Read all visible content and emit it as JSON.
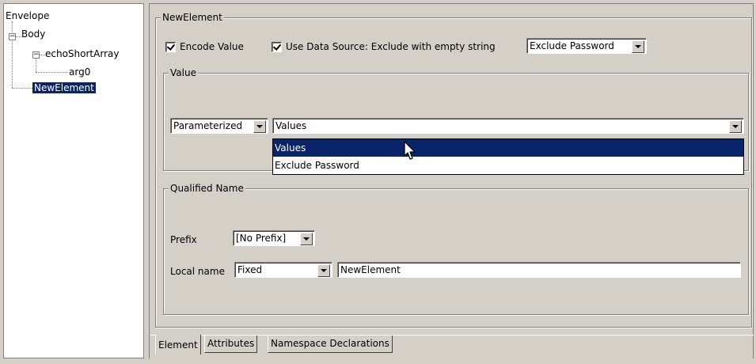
{
  "tree": {
    "nodes": [
      {
        "label": "Envelope"
      },
      {
        "label": "Body"
      },
      {
        "label": "echoShortArray"
      },
      {
        "label": "arg0"
      },
      {
        "label": "NewElement"
      }
    ]
  },
  "element_group": {
    "title": "NewElement",
    "encode_value_label": "Encode Value",
    "use_data_source_label": "Use Data Source: Exclude with empty string",
    "exclude_combo_value": "Exclude Password"
  },
  "value_group": {
    "title": "Value",
    "mode_combo_value": "Parameterized",
    "values_combo_value": "Values",
    "dropdown_options": [
      "Values",
      "Exclude Password"
    ]
  },
  "qualified_name_group": {
    "title": "Qualified Name",
    "prefix_label": "Prefix",
    "prefix_combo_value": "[No Prefix]",
    "local_name_label": "Local name",
    "local_name_mode_value": "Fixed",
    "local_name_value": "NewElement"
  },
  "tabs": [
    "Element",
    "Attributes",
    "Namespace Declarations"
  ]
}
